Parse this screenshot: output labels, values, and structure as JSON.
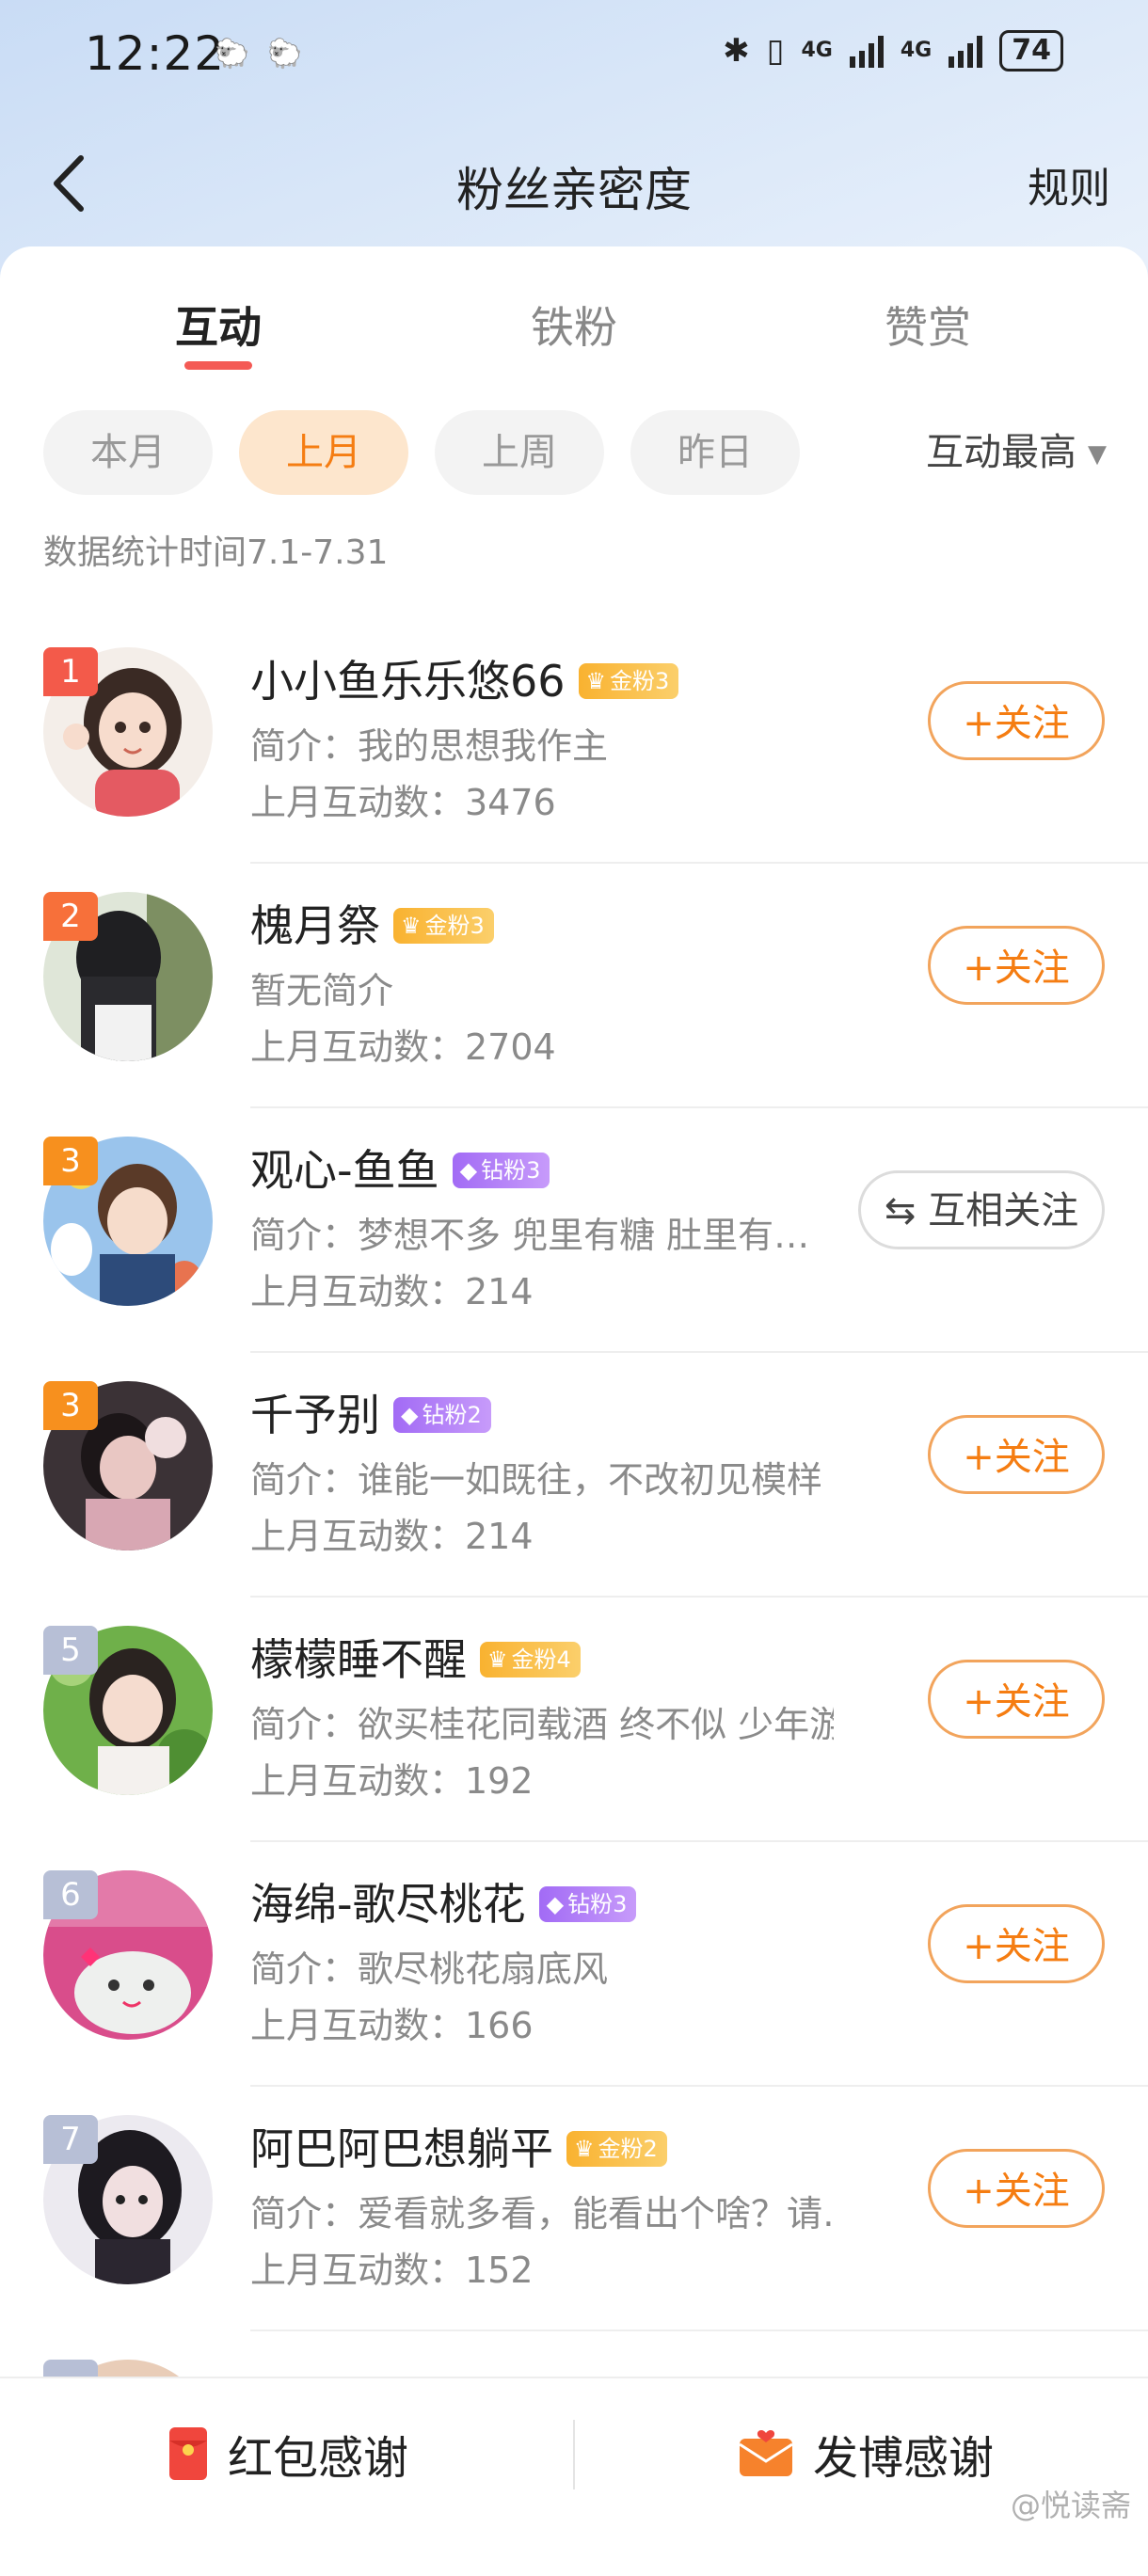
{
  "status_bar": {
    "time": "12:22",
    "net_a": "4G",
    "net_b": "4G",
    "battery": "74"
  },
  "header": {
    "title": "粉丝亲密度",
    "rules_label": "规则"
  },
  "tabs": [
    {
      "label": "互动"
    },
    {
      "label": "铁粉"
    },
    {
      "label": "赞赏"
    }
  ],
  "filters": {
    "chips": [
      {
        "label": "本月"
      },
      {
        "label": "上月"
      },
      {
        "label": "上周"
      },
      {
        "label": "昨日"
      }
    ],
    "selected": "上月",
    "sort_label": "互动最高"
  },
  "stat_range": "数据统计时间7.1-7.31",
  "fans": [
    {
      "rank": "1",
      "name": "小小鱼乐乐悠66",
      "badge": "金粉3",
      "badge_type": "gold",
      "intro": "简介：我的思想我作主",
      "count": "上月互动数：3476",
      "action": "+关注"
    },
    {
      "rank": "2",
      "name": "槐月祭",
      "badge": "金粉3",
      "badge_type": "gold",
      "intro": "暂无简介",
      "count": "上月互动数：2704",
      "action": "+关注"
    },
    {
      "rank": "3",
      "name": "观心-鱼鱼",
      "badge": "钻粉3",
      "badge_type": "diamond",
      "intro": "简介：梦想不多 兜里有糖 肚里有…",
      "count": "上月互动数：214",
      "action": "⇆ 互相关注"
    },
    {
      "rank": "3",
      "name": "千予别",
      "badge": "钻粉2",
      "badge_type": "diamond",
      "intro": "简介：谁能一如既往，不改初见模样",
      "count": "上月互动数：214",
      "action": "+关注"
    },
    {
      "rank": "5",
      "name": "檬檬睡不醒",
      "badge": "金粉4",
      "badge_type": "gold",
      "intro": "简介：欲买桂花同载酒 终不似 少年游",
      "count": "上月互动数：192",
      "action": "+关注"
    },
    {
      "rank": "6",
      "name": "海绵-歌尽桃花",
      "badge": "钻粉3",
      "badge_type": "diamond",
      "intro": "简介：歌尽桃花扇底风",
      "count": "上月互动数：166",
      "action": "+关注"
    },
    {
      "rank": "7",
      "name": "阿巴阿巴想躺平",
      "badge": "金粉2",
      "badge_type": "gold",
      "intro": "简介：爱看就多看，能看出个啥？请…",
      "count": "上月互动数：152",
      "action": "+关注"
    }
  ],
  "bottom_bar": {
    "left_label": "红包感谢",
    "right_label": "发博感谢"
  },
  "watermark": "@悦读斋",
  "colors": {
    "accent": "#f57d12",
    "tab_underline": "#f45a55",
    "gold_badge": "#f9b230",
    "diamond_badge": "#a26bf5"
  }
}
